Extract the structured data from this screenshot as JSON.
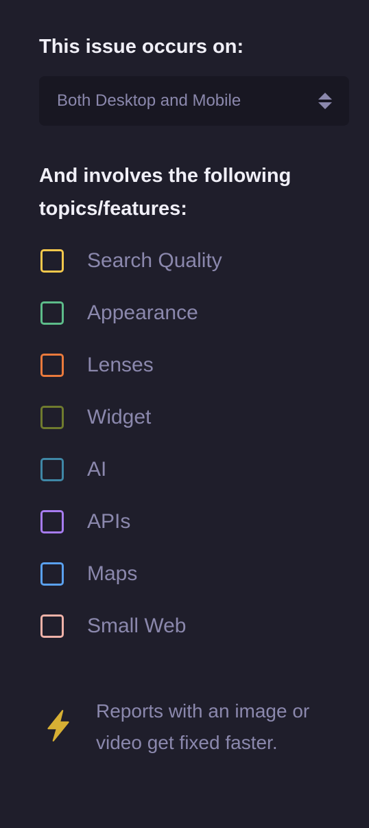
{
  "platform": {
    "label": "This issue occurs on:",
    "selected": "Both Desktop and Mobile"
  },
  "topics": {
    "label": "And involves the following topics/features:",
    "items": [
      {
        "label": "Search Quality",
        "color": "#f5c84c"
      },
      {
        "label": "Appearance",
        "color": "#5dbc8a"
      },
      {
        "label": "Lenses",
        "color": "#ea7a3c"
      },
      {
        "label": "Widget",
        "color": "#6f7b2e"
      },
      {
        "label": "AI",
        "color": "#3f87a6"
      },
      {
        "label": "APIs",
        "color": "#a77cf0"
      },
      {
        "label": "Maps",
        "color": "#5aa1ef"
      },
      {
        "label": "Small Web",
        "color": "#efb2a8"
      }
    ]
  },
  "tip": {
    "icon": "lightning-icon",
    "text": "Reports with an image or video get fixed faster."
  }
}
